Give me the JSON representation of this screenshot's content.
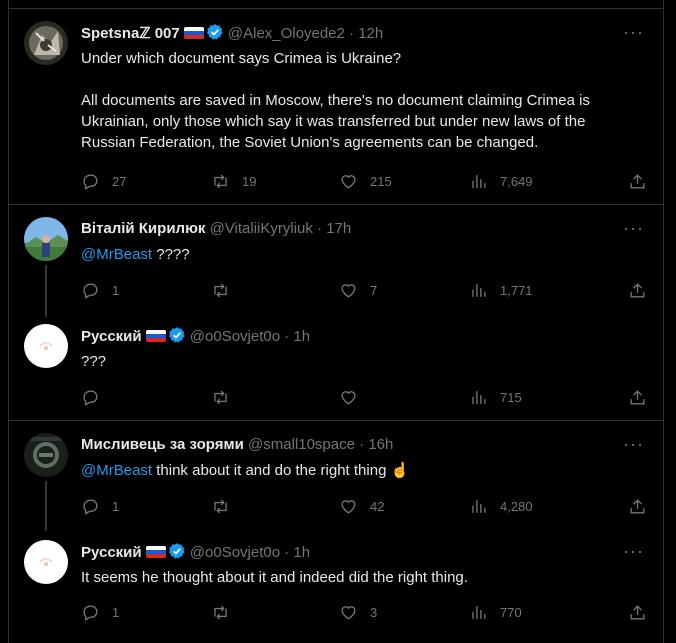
{
  "tweets": [
    {
      "name": "Spetsnaℤ 007",
      "handle": "@Alex_Oloyede2",
      "time": "12h",
      "text": "Under which document says Crimea is Ukraine?",
      "text2": "All documents are saved in Moscow, there's no document claiming Crimea is Ukrainian, only those which say it was transferred but under new laws of the Russian Federation, the Soviet Union's agreements can be changed.",
      "replies": "27",
      "retweets": "19",
      "likes": "215",
      "views": "7,649"
    },
    {
      "name": "Віталій Кирилюк",
      "handle": "@VitaliiKyryliuk",
      "time": "17h",
      "mention": "@MrBeast",
      "text": " ????",
      "replies": "1",
      "retweets": "",
      "likes": "7",
      "views": "1,771"
    },
    {
      "name": "Русский",
      "handle": "@o0Sovjet0o",
      "time": "1h",
      "text": "???",
      "replies": "",
      "retweets": "",
      "likes": "",
      "views": "715"
    },
    {
      "name": "Мисливець за зорями",
      "handle": "@small10space",
      "time": "16h",
      "mention": "@MrBeast",
      "text": " think about it and do the right thing ☝️",
      "replies": "1",
      "retweets": "",
      "likes": "42",
      "views": "4,280"
    },
    {
      "name": "Русский",
      "handle": "@o0Sovjet0o",
      "time": "1h",
      "text": "It seems he thought about it and indeed did the right thing.",
      "replies": "1",
      "retweets": "",
      "likes": "3",
      "views": "770"
    }
  ],
  "ui": {
    "dot": "·",
    "more": "···"
  },
  "colors": {
    "background": "#000000",
    "text": "#e7e9ea",
    "muted": "#71767b",
    "link": "#1d9bf0",
    "verified": "#1d9bf0",
    "border": "#2f3336"
  },
  "icons": [
    "reply-icon",
    "retweet-icon",
    "like-icon",
    "views-icon",
    "share-icon",
    "verified-badge-icon",
    "more-icon"
  ]
}
